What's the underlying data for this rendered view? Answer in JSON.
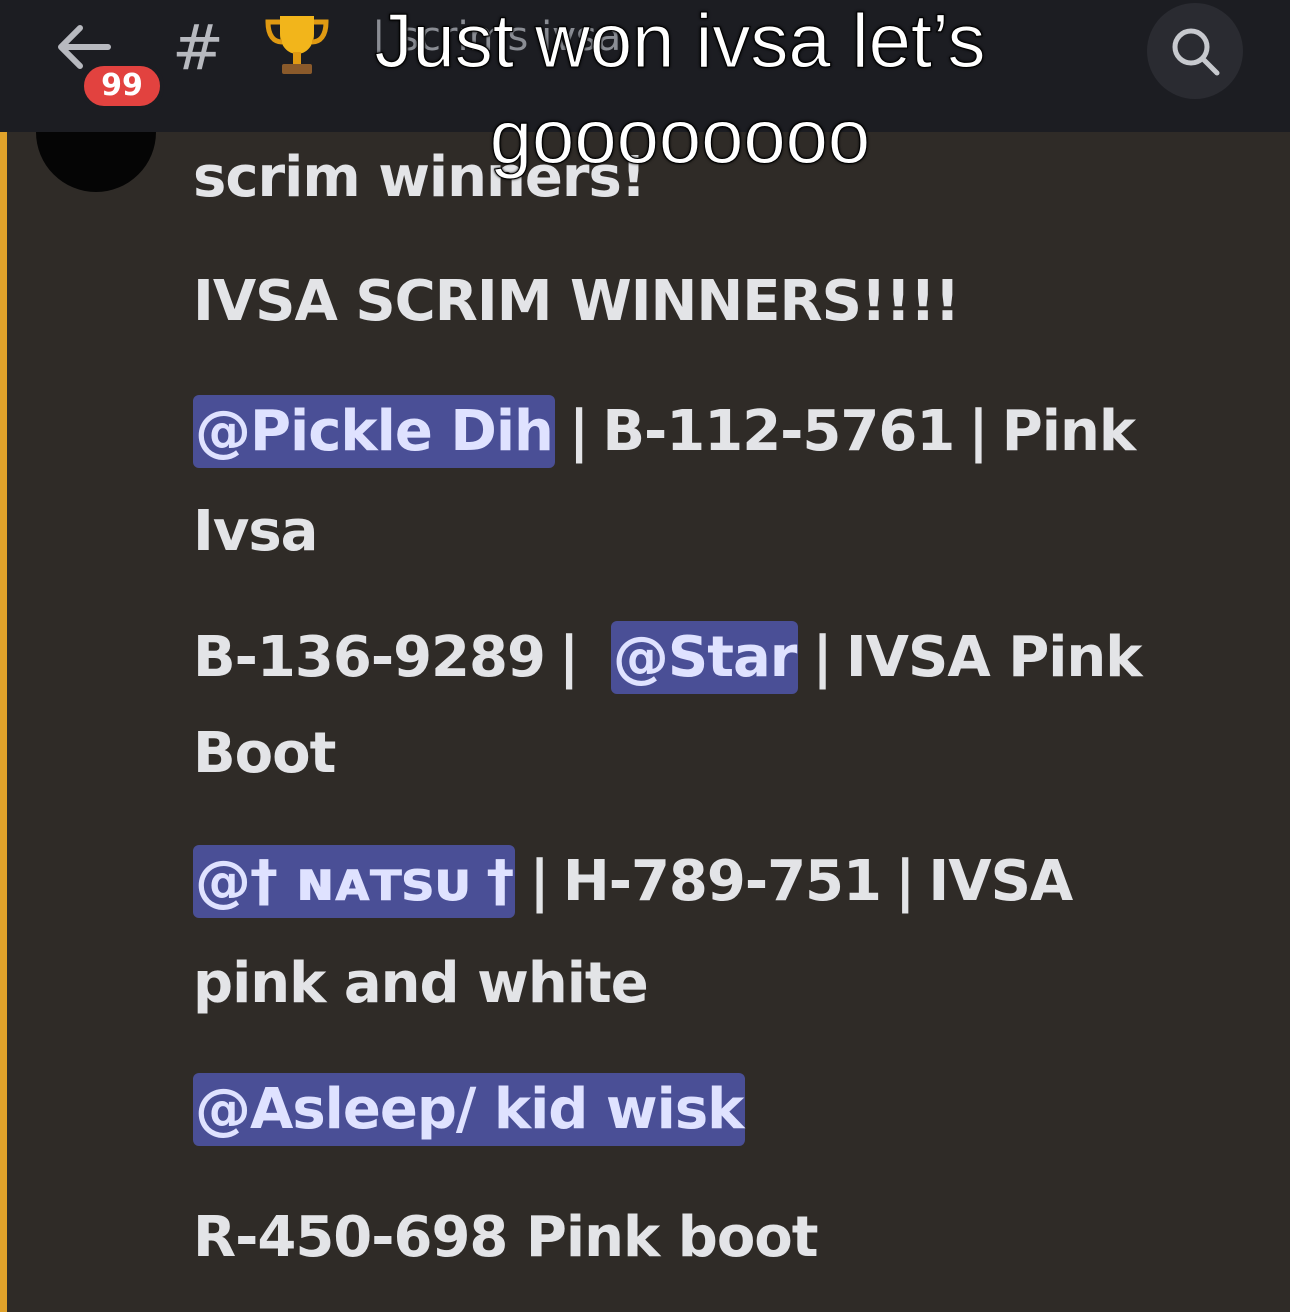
{
  "topbar": {
    "unread_count": "99",
    "channel_symbol": "#",
    "channel_name": "| scrims ivsa"
  },
  "caption": {
    "line1": "Just won ivsa let’s",
    "line2": "goooooooo"
  },
  "message": {
    "heading": "scrim winners!",
    "title": "IVSA SCRIM WINNERS!!!!",
    "entry1": {
      "mention": "@Pickle Dih",
      "sep1": "|",
      "code": "B-112-5761",
      "sep2": "|",
      "desc": "Pink",
      "desc_cont": "Ivsa"
    },
    "entry2": {
      "code": "B-136-9289",
      "sep1": "|",
      "mention": "@Star",
      "sep2": "|",
      "desc": "IVSA Pink",
      "desc_cont": "Boot"
    },
    "entry3": {
      "mention": "@† ɴᴀᴛsᴜ †",
      "sep1": "|",
      "code": "H-789-751",
      "sep2": "|",
      "desc": "IVSA",
      "desc_cont": "pink and white"
    },
    "entry4": {
      "mention": "@Asleep/ kid wisk",
      "code_desc": "R-450-698 Pink boot"
    }
  },
  "colors": {
    "background": "#2f2b27",
    "topbar": "#1c1d22",
    "mention_bg": "#4a4f96",
    "badge": "#e2423f",
    "accent_bar": "#e0a22a"
  }
}
